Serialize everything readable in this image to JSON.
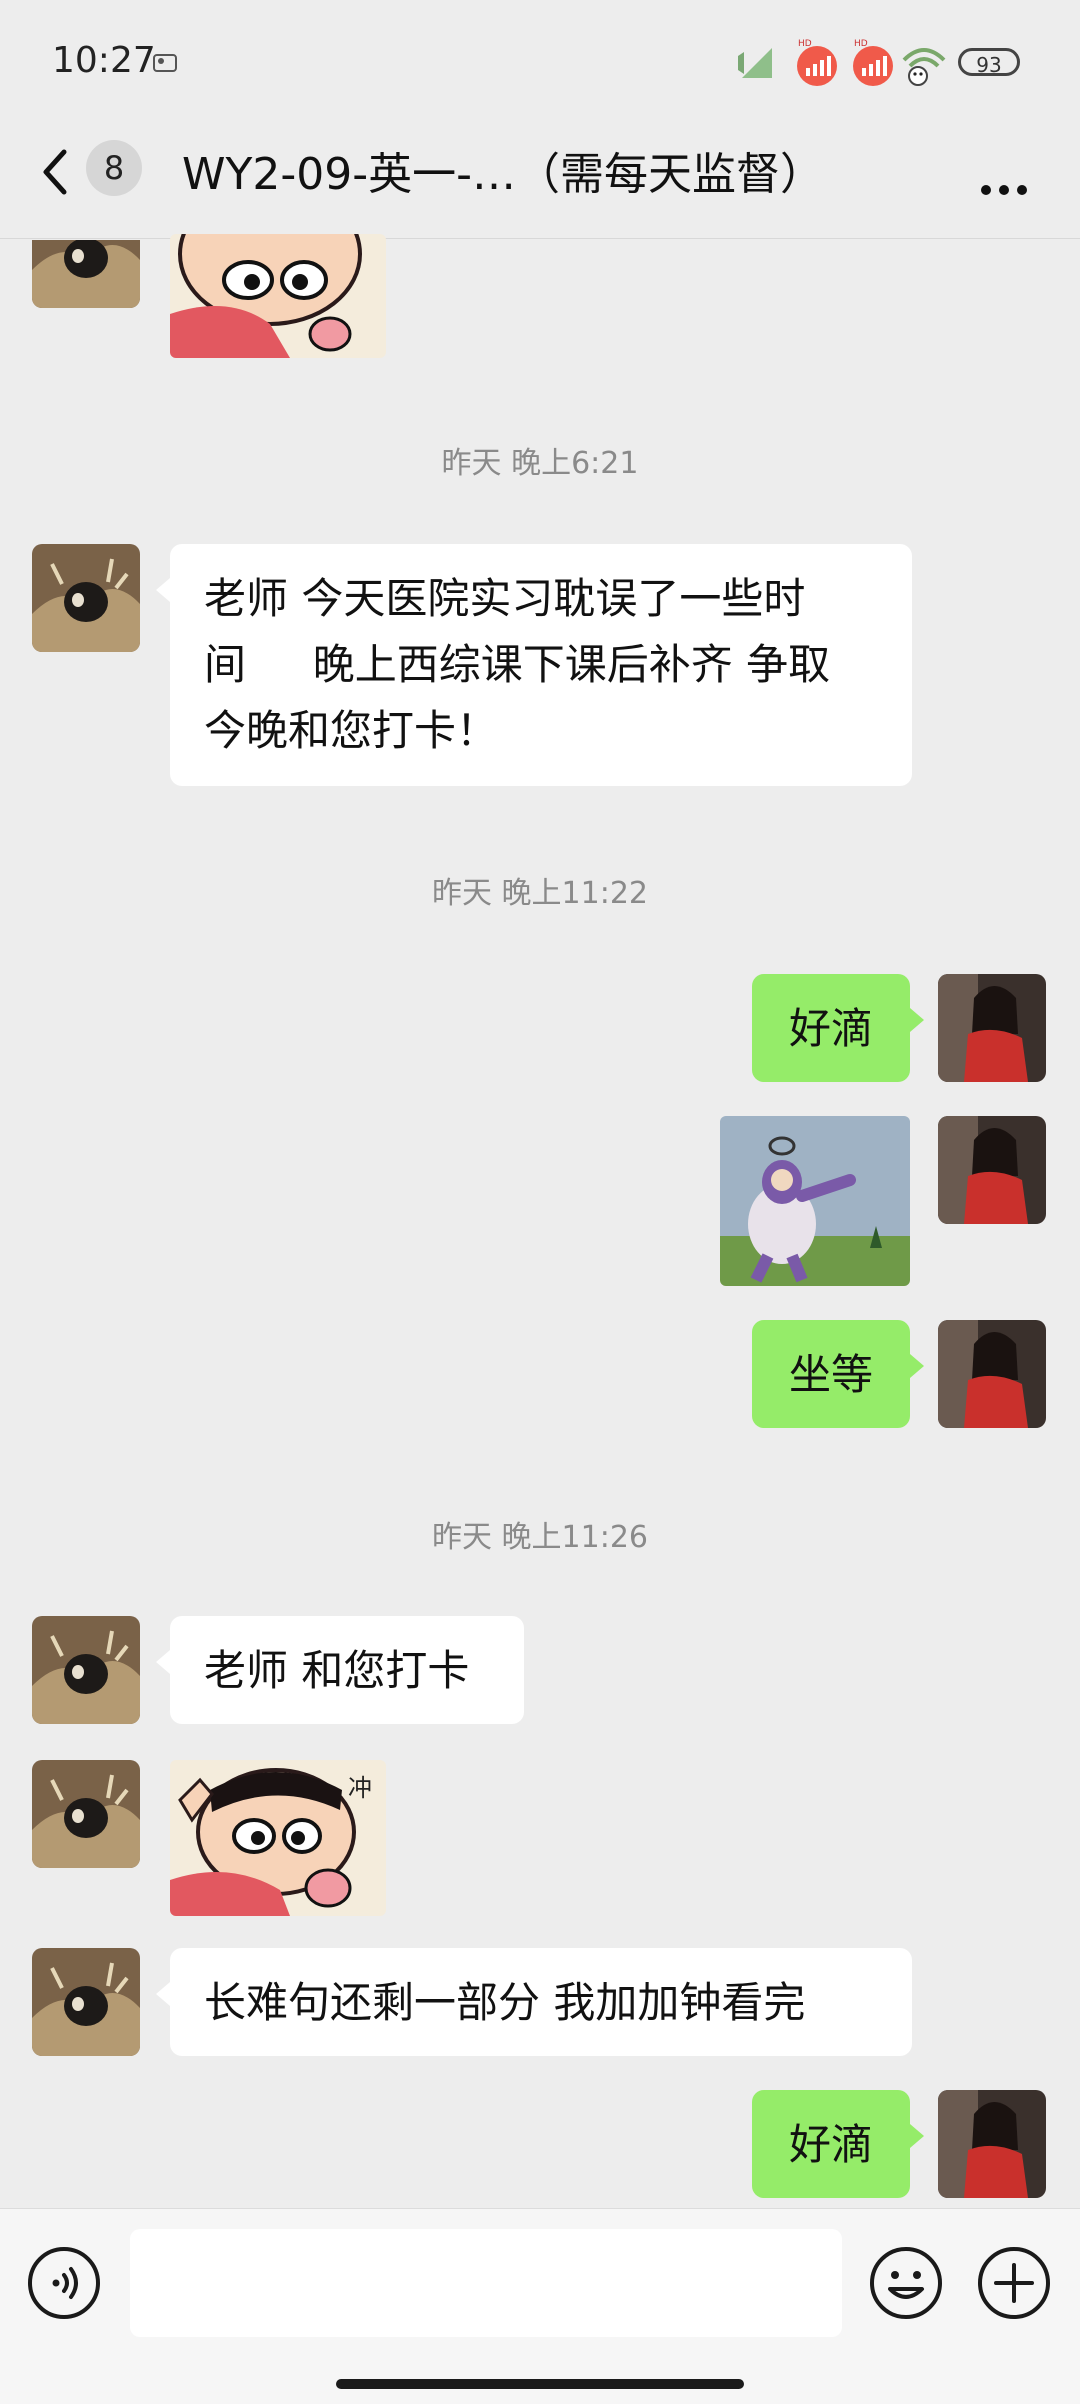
{
  "status_bar": {
    "time": "10:27",
    "battery": "93",
    "icons": [
      "image-notification-icon",
      "mute-icon",
      "hd-signal-icon",
      "hd-signal-icon",
      "wifi-icon"
    ]
  },
  "header": {
    "unread_count": "8",
    "title": "WY2-09-英一-…（需每天监督）",
    "back_icon": "chevron-left-icon",
    "more_icon": "more-dots-icon"
  },
  "messages": [
    {
      "type": "timestamp",
      "text": "昨天 晚上6:21"
    },
    {
      "type": "text",
      "side": "in",
      "lines": [
        "老师 今天医院实习耽误了一些时",
        "间     晚上西综课下课后补齐 争取",
        "今晚和您打卡！"
      ]
    },
    {
      "type": "timestamp",
      "text": "昨天 晚上11:22"
    },
    {
      "type": "text",
      "side": "out",
      "text": "好滴"
    },
    {
      "type": "image",
      "side": "out",
      "description": "teletubby-sticker"
    },
    {
      "type": "text",
      "side": "out",
      "text": "坐等"
    },
    {
      "type": "timestamp",
      "text": "昨天 晚上11:26"
    },
    {
      "type": "text",
      "side": "in",
      "text": "老师 和您打卡"
    },
    {
      "type": "image",
      "side": "in",
      "description": "cartoon-boy-sticker",
      "sticker_text": "冲"
    },
    {
      "type": "text",
      "side": "in",
      "text": "长难句还剩一部分 我加加钟看完"
    },
    {
      "type": "text",
      "side": "out",
      "text": "好滴"
    }
  ],
  "input_bar": {
    "voice_icon": "voice-icon",
    "emoji_icon": "emoji-icon",
    "plus_icon": "plus-icon",
    "input_value": ""
  },
  "colors": {
    "background": "#ededed",
    "outgoing_bubble": "#95ec69",
    "incoming_bubble": "#ffffff",
    "timestamp_text": "#8a8a8a"
  }
}
